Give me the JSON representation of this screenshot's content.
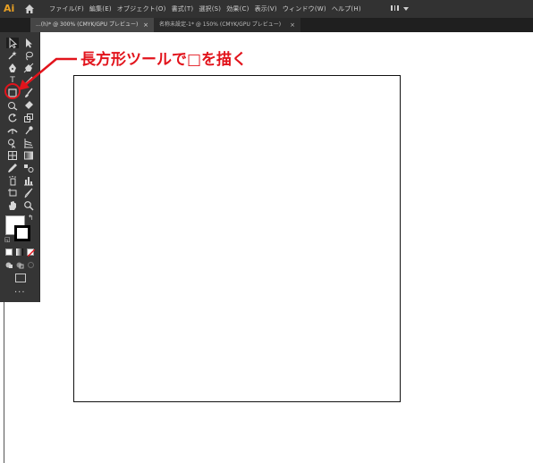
{
  "app": {
    "logo": "Ai"
  },
  "menu": {
    "items": [
      "ファイル(F)",
      "編集(E)",
      "オブジェクト(O)",
      "書式(T)",
      "選択(S)",
      "効果(C)",
      "表示(V)",
      "ウィンドウ(W)",
      "ヘルプ(H)"
    ]
  },
  "tabs": [
    {
      "label": "...(h)* @ 300% (CMYK/GPU プレビュー)",
      "close": "×",
      "active": true
    },
    {
      "label": "名称未設定-1* @ 150% (CMYK/GPU プレビュー)",
      "close": "×",
      "active": false
    }
  ],
  "tools": {
    "type_glyph": "T",
    "more_glyph": "...",
    "swap_glyph": "↰",
    "default_glyph": "◱"
  },
  "annotation": {
    "text": "長方形ツールで□を描く",
    "color": "#e2141c"
  },
  "colors": {
    "menubar": "#323232",
    "tabbar": "#1f1f1f",
    "toolpanel": "#353535",
    "accent_red": "#e2141c",
    "fill": "#ffffff",
    "stroke": "#000000"
  },
  "icons": [
    "home-icon",
    "selection-tool-icon",
    "direct-selection-tool-icon",
    "magic-wand-icon",
    "lasso-icon",
    "pen-tool-icon",
    "curvature-tool-icon",
    "type-tool-icon",
    "line-tool-icon",
    "rectangle-tool-icon",
    "paintbrush-icon",
    "shaper-tool-icon",
    "eraser-icon",
    "rotate-tool-icon",
    "scale-tool-icon",
    "width-tool-icon",
    "puppet-warp-icon",
    "shape-builder-icon",
    "perspective-grid-icon",
    "mesh-tool-icon",
    "gradient-tool-icon",
    "eyedropper-icon",
    "blend-tool-icon",
    "symbol-sprayer-icon",
    "graph-tool-icon",
    "artboard-tool-icon",
    "slice-tool-icon",
    "hand-tool-icon",
    "zoom-tool-icon"
  ]
}
